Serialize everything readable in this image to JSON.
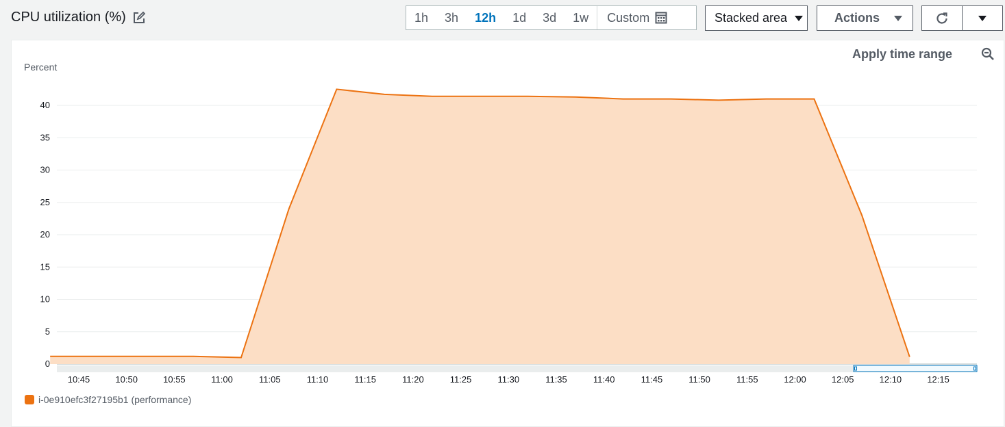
{
  "header": {
    "title": "CPU utilization (%)",
    "ranges": [
      "1h",
      "3h",
      "12h",
      "1d",
      "3d",
      "1w"
    ],
    "active_range": "12h",
    "custom_label": "Custom",
    "chart_type_label": "Stacked area",
    "actions_label": "Actions"
  },
  "panel": {
    "apply_label": "Apply time range"
  },
  "icons": [
    "edit-icon",
    "calendar-icon",
    "caret-down-icon",
    "refresh-icon",
    "zoom-out-icon"
  ],
  "colors": {
    "series": "#ec7211",
    "area": "#fcdec5",
    "accent": "#0073bb"
  },
  "chart_data": {
    "type": "area",
    "ylabel": "Percent",
    "ylim": [
      0,
      42
    ],
    "yticks": [
      0,
      5,
      10,
      15,
      20,
      25,
      30,
      35,
      40
    ],
    "xticks": [
      "10:45",
      "10:50",
      "10:55",
      "11:00",
      "11:05",
      "11:10",
      "11:15",
      "11:20",
      "11:25",
      "11:30",
      "11:35",
      "11:40",
      "11:45",
      "11:50",
      "11:55",
      "12:00",
      "12:05",
      "12:10",
      "12:15"
    ],
    "grid": true,
    "series": [
      {
        "name": "i-0e910efc3f27195b1 (performance)",
        "points": [
          [
            "10:42",
            1.2
          ],
          [
            "10:47",
            1.2
          ],
          [
            "10:52",
            1.2
          ],
          [
            "10:57",
            1.2
          ],
          [
            "11:02",
            1.0
          ],
          [
            "11:07",
            24
          ],
          [
            "11:12",
            42.5
          ],
          [
            "11:17",
            41.7
          ],
          [
            "11:22",
            41.4
          ],
          [
            "11:27",
            41.4
          ],
          [
            "11:32",
            41.4
          ],
          [
            "11:37",
            41.3
          ],
          [
            "11:42",
            41.0
          ],
          [
            "11:47",
            41.0
          ],
          [
            "11:52",
            40.8
          ],
          [
            "11:57",
            41.0
          ],
          [
            "12:02",
            41.0
          ],
          [
            "12:07",
            23
          ],
          [
            "12:12",
            1.1
          ]
        ]
      }
    ],
    "legend": "bottom-left"
  }
}
